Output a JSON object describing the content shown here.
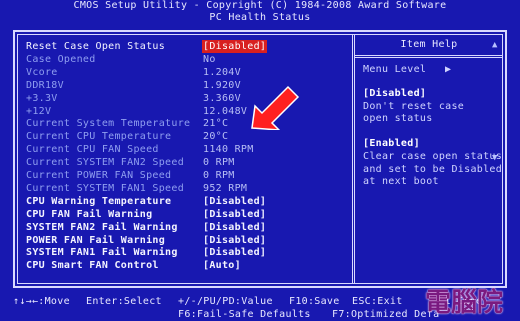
{
  "header": {
    "line1": "CMOS Setup Utility - Copyright (C) 1984-2008 Award Software",
    "line2": "PC Health Status"
  },
  "items": [
    {
      "label": "Reset Case Open Status",
      "value": "[Disabled]",
      "state": "selected"
    },
    {
      "label": "Case Opened",
      "value": "No",
      "state": "readonly"
    },
    {
      "label": "Vcore",
      "value": "1.204V",
      "state": "readonly"
    },
    {
      "label": "DDR18V",
      "value": "1.920V",
      "state": "readonly"
    },
    {
      "label": "+3.3V",
      "value": "3.360V",
      "state": "readonly"
    },
    {
      "label": "+12V",
      "value": "12.048V",
      "state": "readonly"
    },
    {
      "label": "Current System Temperature",
      "value": "21°C",
      "state": "readonly"
    },
    {
      "label": "Current CPU Temperature",
      "value": "20°C",
      "state": "readonly"
    },
    {
      "label": "Current CPU FAN Speed",
      "value": "1140 RPM",
      "state": "readonly"
    },
    {
      "label": "Current SYSTEM FAN2 Speed",
      "value": "0 RPM",
      "state": "readonly"
    },
    {
      "label": "Current POWER FAN Speed",
      "value": "0 RPM",
      "state": "readonly"
    },
    {
      "label": "Current SYSTEM FAN1 Speed",
      "value": "952 RPM",
      "state": "readonly"
    },
    {
      "label": "CPU Warning Temperature",
      "value": "[Disabled]",
      "state": "editable"
    },
    {
      "label": "CPU FAN Fail Warning",
      "value": "[Disabled]",
      "state": "editable"
    },
    {
      "label": "SYSTEM FAN2 Fail Warning",
      "value": "[Disabled]",
      "state": "editable"
    },
    {
      "label": "POWER FAN Fail Warning",
      "value": "[Disabled]",
      "state": "editable"
    },
    {
      "label": "SYSTEM FAN1 Fail Warning",
      "value": "[Disabled]",
      "state": "editable"
    },
    {
      "label": "CPU Smart FAN Control",
      "value": "[Auto]",
      "state": "editable"
    }
  ],
  "help": {
    "title": "Item Help",
    "menu_level": "Menu Level",
    "menu_arrow": "▶",
    "lines": [
      {
        "text": "[Disabled]",
        "head": true
      },
      {
        "text": "Don't reset case",
        "head": false
      },
      {
        "text": "open status",
        "head": false
      },
      {
        "text": "",
        "head": false
      },
      {
        "text": "[Enabled]",
        "head": true
      },
      {
        "text": "Clear case open status",
        "head": false
      },
      {
        "text": "and set to be Disabled",
        "head": false
      },
      {
        "text": "at next boot",
        "head": false
      }
    ]
  },
  "footer": {
    "move": "↑↓→←:Move",
    "enter": "Enter:Select",
    "value": "+/-/PU/PD:Value",
    "save": "F10:Save",
    "esc": "ESC:Exit",
    "help": "F1:Gene",
    "failsafe": "F6:Fail-Safe Defaults",
    "optimized": "F7:Optimized Defa"
  },
  "watermark": "電腦院",
  "colors": {
    "background": "#1818b0",
    "selected_bg": "#d82020",
    "readonly_text": "#8f9ef0",
    "annotation_arrow": "#ff2020"
  }
}
